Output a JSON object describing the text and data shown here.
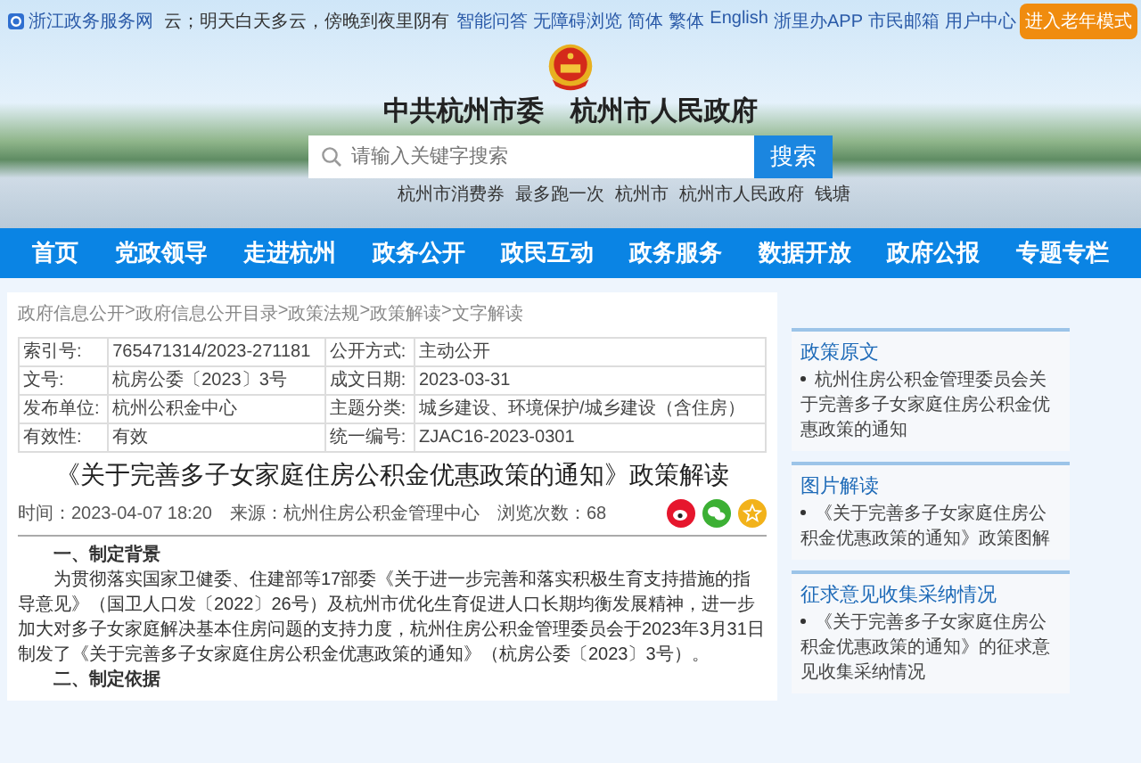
{
  "top_bar": {
    "site_name": "浙江政务服务网",
    "ticker": "云；明天白天多云，傍晚到夜里阴有",
    "links": [
      "智能问答",
      "无障碍浏览",
      "简体",
      "繁体",
      "English",
      "浙里办APP",
      "市民邮箱",
      "用户中心"
    ],
    "elder_button": "进入老年模式"
  },
  "banner": {
    "title": "中共杭州市委　杭州市人民政府",
    "search": {
      "placeholder": "请输入关键字搜索",
      "button": "搜索"
    },
    "hot_words": [
      "杭州市消费券",
      "最多跑一次",
      "杭州市",
      "杭州市人民政府",
      "钱塘"
    ]
  },
  "nav": [
    "首页",
    "党政领导",
    "走进杭州",
    "政务公开",
    "政民互动",
    "政务服务",
    "数据开放",
    "政府公报",
    "专题专栏"
  ],
  "breadcrumb": {
    "separator": ">",
    "items": [
      "政府信息公开",
      "政府信息公开目录",
      "政策法规",
      "政策解读",
      "文字解读"
    ]
  },
  "info_table": [
    [
      "索引号:",
      "765471314/2023-271181",
      "公开方式:",
      "主动公开"
    ],
    [
      "文号:",
      "杭房公委〔2023〕3号",
      "成文日期:",
      "2023-03-31"
    ],
    [
      "发布单位:",
      "杭州公积金中心",
      "主题分类:",
      "城乡建设、环境保护/城乡建设（含住房）"
    ],
    [
      "有效性:",
      "有效",
      "统一编号:",
      "ZJAC16-2023-0301"
    ]
  ],
  "article": {
    "title": "《关于完善多子女家庭住房公积金优惠政策的通知》政策解读",
    "meta": [
      "时间：2023-04-07 18:20",
      "来源：杭州住房公积金管理中心",
      "浏览次数：68"
    ],
    "sections": [
      {
        "heading": "一、制定背景",
        "paragraphs": [
          "为贯彻落实国家卫健委、住建部等17部委《关于进一步完善和落实积极生育支持措施的指导意见》（国卫人口发〔2022〕26号）及杭州市优化生育促进人口长期均衡发展精神，进一步加大对多子女家庭解决基本住房问题的支持力度，杭州住房公积金管理委员会于2023年3月31日制发了《关于完善多子女家庭住房公积金优惠政策的通知》（杭房公委〔2023〕3号）。"
        ]
      },
      {
        "heading": "二、制定依据"
      }
    ]
  },
  "sidebar": [
    {
      "title": "政策原文",
      "items": [
        "杭州住房公积金管理委员会关于完善多子女家庭住房公积金优惠政策的通知"
      ]
    },
    {
      "title": "图片解读",
      "items": [
        "《关于完善多子女家庭住房公积金优惠政策的通知》政策图解"
      ]
    },
    {
      "title": "征求意见收集采纳情况",
      "items": [
        "《关于完善多子女家庭住房公积金优惠政策的通知》的征求意见收集采纳情况"
      ]
    }
  ]
}
